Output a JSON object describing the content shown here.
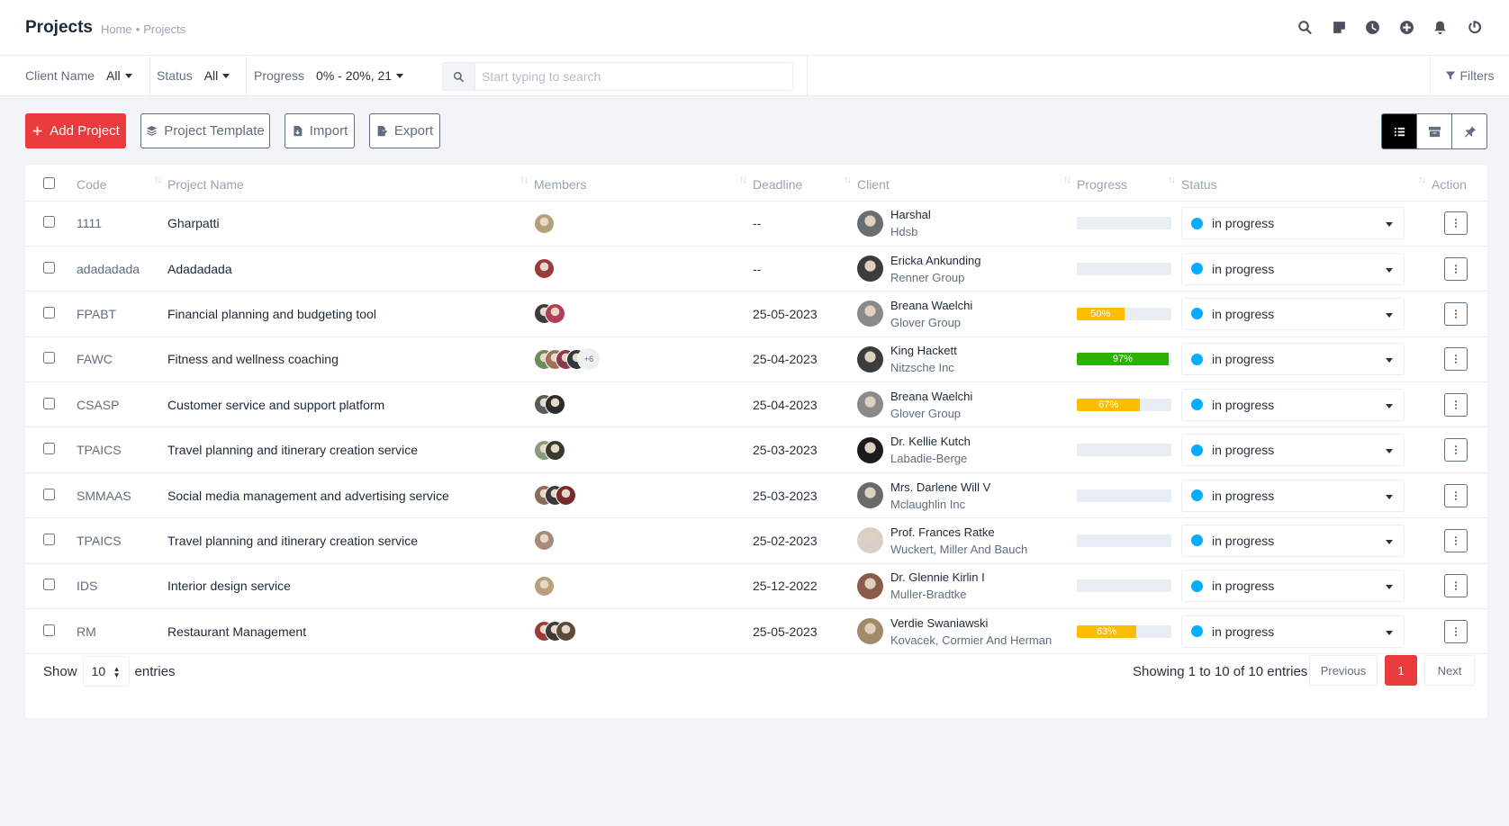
{
  "header": {
    "title": "Projects",
    "breadcrumb": [
      "Home",
      "Projects"
    ],
    "breadcrumb_sep": "•",
    "icons": [
      "search-icon",
      "sticky-note-icon",
      "clock-icon",
      "plus-circle-icon",
      "bell-icon",
      "power-icon"
    ]
  },
  "filters": {
    "client": {
      "label": "Client Name",
      "value": "All"
    },
    "status": {
      "label": "Status",
      "value": "All"
    },
    "progress": {
      "label": "Progress",
      "value": "0% - 20%, 21"
    },
    "search_placeholder": "Start typing to search",
    "filters_label": "Filters"
  },
  "actions": {
    "add": "Add Project",
    "template": "Project Template",
    "import": "Import",
    "export": "Export"
  },
  "table": {
    "columns": [
      "Code",
      "Project Name",
      "Members",
      "Deadline",
      "Client",
      "Progress",
      "Status",
      "Action"
    ],
    "rows": [
      {
        "code": "1111",
        "name": "Gharpatti",
        "members": 1,
        "member_colors": [
          "#b4a078"
        ],
        "more": "",
        "deadline": "--",
        "client": "Harshal",
        "company": "Hdsb",
        "progress": 0,
        "progress_label": "",
        "progress_color": "",
        "status": "in progress",
        "client_color": "#6a6e70"
      },
      {
        "code": "adadadada",
        "name": "Adadadada",
        "members": 1,
        "member_colors": [
          "#9a3a3a"
        ],
        "more": "",
        "deadline": "--",
        "client": "Ericka Ankunding",
        "company": "Renner Group",
        "progress": 0,
        "progress_label": "",
        "progress_color": "",
        "status": "in progress",
        "client_color": "#3c3c3c"
      },
      {
        "code": "FPABT",
        "name": "Financial planning and budgeting tool",
        "members": 2,
        "member_colors": [
          "#3c3c3c",
          "#b0405a"
        ],
        "more": "",
        "deadline": "25-05-2023",
        "client": "Breana Waelchi",
        "company": "Glover Group",
        "progress": 50,
        "progress_label": "50%",
        "progress_color": "#fcbd01",
        "status": "in progress",
        "client_color": "#8a8a8a"
      },
      {
        "code": "FAWC",
        "name": "Fitness and wellness coaching",
        "members": 4,
        "member_colors": [
          "#6d8a5a",
          "#a0705a",
          "#8a3a4a",
          "#2c3a3a"
        ],
        "more": "+6",
        "deadline": "25-04-2023",
        "client": "King Hackett",
        "company": "Nitzsche Inc",
        "progress": 97,
        "progress_label": "97%",
        "progress_color": "#2cb100",
        "status": "in progress",
        "client_color": "#3c3c3c"
      },
      {
        "code": "CSASP",
        "name": "Customer service and support platform",
        "members": 2,
        "member_colors": [
          "#5a5a5a",
          "#2c2c2c"
        ],
        "more": "",
        "deadline": "25-04-2023",
        "client": "Breana Waelchi",
        "company": "Glover Group",
        "progress": 67,
        "progress_label": "67%",
        "progress_color": "#fcbd01",
        "status": "in progress",
        "client_color": "#8a8a8a"
      },
      {
        "code": "TPAICS",
        "name": "Travel planning and itinerary creation service",
        "members": 2,
        "member_colors": [
          "#8a9a7a",
          "#3a3a2a"
        ],
        "more": "",
        "deadline": "25-03-2023",
        "client": "Dr. Kellie Kutch",
        "company": "Labadie-Berge",
        "progress": 0,
        "progress_label": "",
        "progress_color": "",
        "status": "in progress",
        "client_color": "#1c1c1c"
      },
      {
        "code": "SMMAAS",
        "name": "Social media management and advertising service",
        "members": 3,
        "member_colors": [
          "#8a6a5a",
          "#3a3a3a",
          "#7a2a2a"
        ],
        "more": "",
        "deadline": "25-03-2023",
        "client": "Mrs. Darlene Will V",
        "company": "Mclaughlin Inc",
        "progress": 0,
        "progress_label": "",
        "progress_color": "",
        "status": "in progress",
        "client_color": "#6a6a6a"
      },
      {
        "code": "TPAICS",
        "name": "Travel planning and itinerary creation service",
        "members": 1,
        "member_colors": [
          "#a88a7a"
        ],
        "more": "",
        "deadline": "25-02-2023",
        "client": "Prof. Frances Ratke",
        "company": "Wuckert, Miller And Bauch",
        "progress": 0,
        "progress_label": "",
        "progress_color": "",
        "status": "in progress",
        "client_color": "#d8d0c8"
      },
      {
        "code": "IDS",
        "name": "Interior design service",
        "members": 1,
        "member_colors": [
          "#b8a078"
        ],
        "more": "",
        "deadline": "25-12-2022",
        "client": "Dr. Glennie Kirlin I",
        "company": "Muller-Bradtke",
        "progress": 0,
        "progress_label": "",
        "progress_color": "",
        "status": "in progress",
        "client_color": "#8a5a4a"
      },
      {
        "code": "RM",
        "name": "Restaurant Management",
        "members": 3,
        "member_colors": [
          "#9a3a3a",
          "#3a3a3a",
          "#5a4a3a"
        ],
        "more": "",
        "deadline": "25-05-2023",
        "client": "Verdie Swaniawski",
        "company": "Kovacek, Cormier And Herman",
        "progress": 63,
        "progress_label": "63%",
        "progress_color": "#fcbd01",
        "status": "in progress",
        "client_color": "#a08a6a"
      }
    ]
  },
  "footer": {
    "show": "Show",
    "length": "10",
    "entries": "entries",
    "info": "Showing 1 to 10 of 10 entries",
    "previous": "Previous",
    "page": "1",
    "next": "Next"
  }
}
